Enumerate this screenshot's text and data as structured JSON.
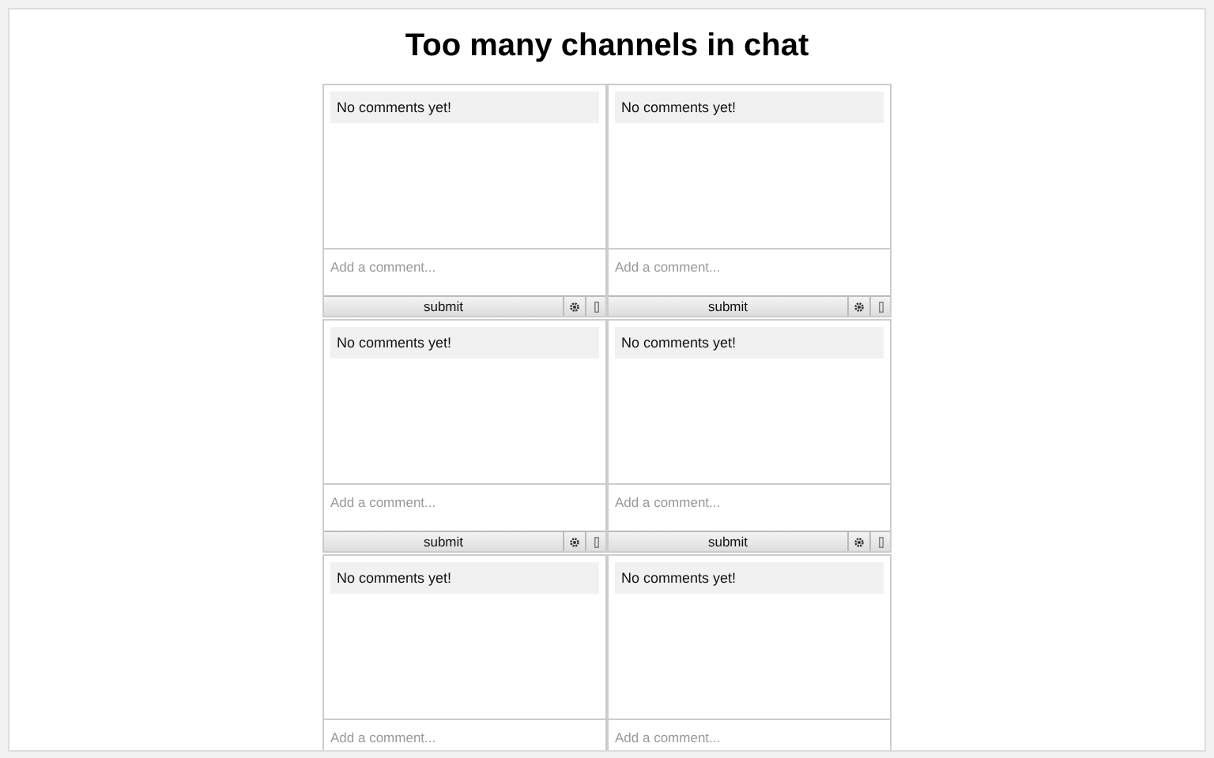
{
  "title": "Too many channels in chat",
  "chats": [
    {
      "message": "No comments yet!",
      "placeholder": "Add a comment...",
      "submit": "submit"
    },
    {
      "message": "No comments yet!",
      "placeholder": "Add a comment...",
      "submit": "submit"
    },
    {
      "message": "No comments yet!",
      "placeholder": "Add a comment...",
      "submit": "submit"
    },
    {
      "message": "No comments yet!",
      "placeholder": "Add a comment...",
      "submit": "submit"
    },
    {
      "message": "No comments yet!",
      "placeholder": "Add a comment..."
    },
    {
      "message": "No comments yet!",
      "placeholder": "Add a comment..."
    }
  ]
}
